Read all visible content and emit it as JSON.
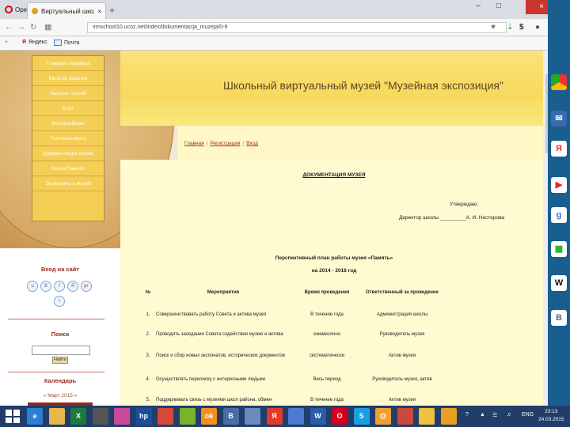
{
  "browser": {
    "app_label": "Opera",
    "tab_title": "Виртуальный школьн",
    "tab_close": "×",
    "new_tab": "+",
    "url": "irmschool10.ucoz.net/index/dokumentacija_muzeja/0-9",
    "win_close": "×",
    "bookmarks": [
      {
        "label": "Яндекс"
      },
      {
        "label": "Почта"
      }
    ]
  },
  "site": {
    "title": "Школьный виртуальный музей \"Музейная экспозиция\"",
    "menu": [
      "Главная страница",
      "Каталог файлов",
      "Каталог статей",
      "Блог",
      "Фотоальбомы",
      "Гостевая книга",
      "Документация музея",
      "Книга Памяти",
      "Экспонаты в музей"
    ],
    "top_links": [
      "Главная",
      "Регистрация",
      "Вход"
    ],
    "login_heading": "Вход на сайт",
    "social_icons": [
      "u",
      "B",
      "f",
      "Я",
      "g+",
      "t"
    ],
    "search_heading": "Поиск",
    "search_button": "Найти",
    "calendar_heading": "Календарь",
    "calendar_month": "« Март 2015 »"
  },
  "doc": {
    "heading": "ДОКУМЕНТАЦИЯ МУЗЕЯ",
    "approve": "Утверждаю:",
    "director": "Директор школы _________А. И. Нестерова",
    "plan_title": "Перспективный  план работы  музея «Память»",
    "plan_years": "на 2014 - 2018 год",
    "columns": [
      "№",
      "Мероприятия",
      "Время проведения",
      "Ответственный за проведение"
    ],
    "rows": [
      {
        "n": "1.",
        "event": "Совершенствовать работу Совета и актива музея",
        "time": "В течение года",
        "resp": "Администрация школы"
      },
      {
        "n": "2.",
        "event": "Проводить заседания Совета содействия музею и актива",
        "time": "ежемесячно",
        "resp": "Руководитель музея"
      },
      {
        "n": "3.",
        "event": "Поиск и сбор новых экспонатов, исторических документов",
        "time": "систематически",
        "resp": "Актив музея"
      },
      {
        "n": "4.",
        "event": "Осуществлять переписку с интересными людьми",
        "time": "Весь период",
        "resp": "Руководитель музея, актив"
      },
      {
        "n": "5.",
        "event": "Поддерживать связь с музеями школ района, обмен",
        "time": "В течение года",
        "resp": "Актив музея"
      }
    ]
  },
  "rightbar_icons": [
    "chrome-icon",
    "mail-icon",
    "yandex-icon",
    "youtube-icon",
    "google-icon",
    "apps-icon",
    "wikipedia-icon",
    "vk-icon"
  ],
  "taskbar": {
    "lang": "ENG",
    "time": "23:13",
    "date": "24.03.2015",
    "icons": [
      {
        "name": "ie-icon",
        "label": "e",
        "color": "#2a7fd4"
      },
      {
        "name": "folder-icon",
        "label": "",
        "color": "#e8b84a"
      },
      {
        "name": "excel-icon",
        "label": "X",
        "color": "#1d7a3e"
      },
      {
        "name": "camera-icon",
        "label": "",
        "color": "#555555"
      },
      {
        "name": "paint-icon",
        "label": "",
        "color": "#c94a9a"
      },
      {
        "name": "hp-icon",
        "label": "hp",
        "color": "#1a4f9a"
      },
      {
        "name": "chrome-icon",
        "label": "",
        "color": "#d84838"
      },
      {
        "name": "android-icon",
        "label": "",
        "color": "#7ab22a"
      },
      {
        "name": "odnoklassniki-icon",
        "label": "ok",
        "color": "#f29022"
      },
      {
        "name": "vk-icon",
        "label": "B",
        "color": "#4a6ea0"
      },
      {
        "name": "speaker-icon",
        "label": "",
        "color": "#6a8ac0"
      },
      {
        "name": "yandex-icon",
        "label": "Я",
        "color": "#e03a2a"
      },
      {
        "name": "mail-icon",
        "label": "",
        "color": "#4a7bd0"
      },
      {
        "name": "word-icon",
        "label": "W",
        "color": "#2a5aa8"
      },
      {
        "name": "opera-icon",
        "label": "O",
        "color": "#d4001b"
      },
      {
        "name": "skype-icon",
        "label": "S",
        "color": "#1aa0e0"
      },
      {
        "name": "agent-icon",
        "label": "@",
        "color": "#f0a030"
      },
      {
        "name": "picasa-icon",
        "label": "",
        "color": "#c94a3a"
      },
      {
        "name": "gallery-icon",
        "label": "",
        "color": "#f0c040"
      },
      {
        "name": "search-icon",
        "label": "",
        "color": "#e8a020"
      }
    ]
  }
}
